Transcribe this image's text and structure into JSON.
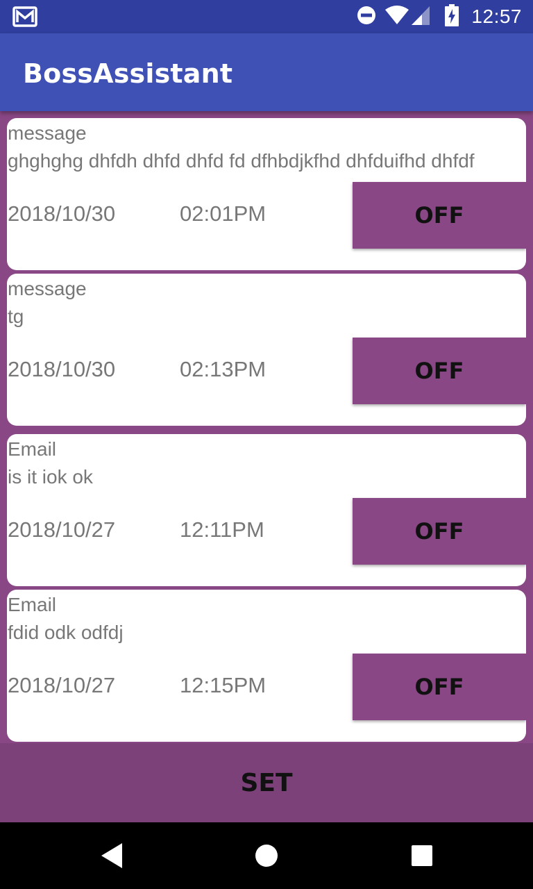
{
  "status_bar": {
    "time": "12:57",
    "icons": [
      "gmail-icon",
      "do-not-disturb-icon",
      "wifi-icon",
      "cell-signal-icon",
      "battery-charging-icon"
    ]
  },
  "app_bar": {
    "title": "BossAssistant"
  },
  "items": [
    {
      "type": "message",
      "body": "ghghghg dhfdh dhfd dhfd fd dfhbdjkfhd dhfduifhd dhfdf",
      "date": "2018/10/30",
      "time": "02:01PM",
      "toggle": "OFF"
    },
    {
      "type": "message",
      "body": "tg",
      "date": "2018/10/30",
      "time": "02:13PM",
      "toggle": "OFF"
    },
    {
      "type": "Email",
      "body": "is it iok ok",
      "date": "2018/10/27",
      "time": "12:11PM",
      "toggle": "OFF"
    },
    {
      "type": "Email",
      "body": "fdid odk odfdj",
      "date": "2018/10/27",
      "time": "12:15PM",
      "toggle": "OFF"
    }
  ],
  "set_button": {
    "label": "SET"
  },
  "nav_bar": {
    "icons": [
      "back-icon",
      "home-icon",
      "recents-icon"
    ]
  },
  "colors": {
    "status_bar": "#303f9f",
    "app_bar": "#3f51b5",
    "accent_purple": "#8a4785",
    "set_bar": "#7b4178"
  }
}
